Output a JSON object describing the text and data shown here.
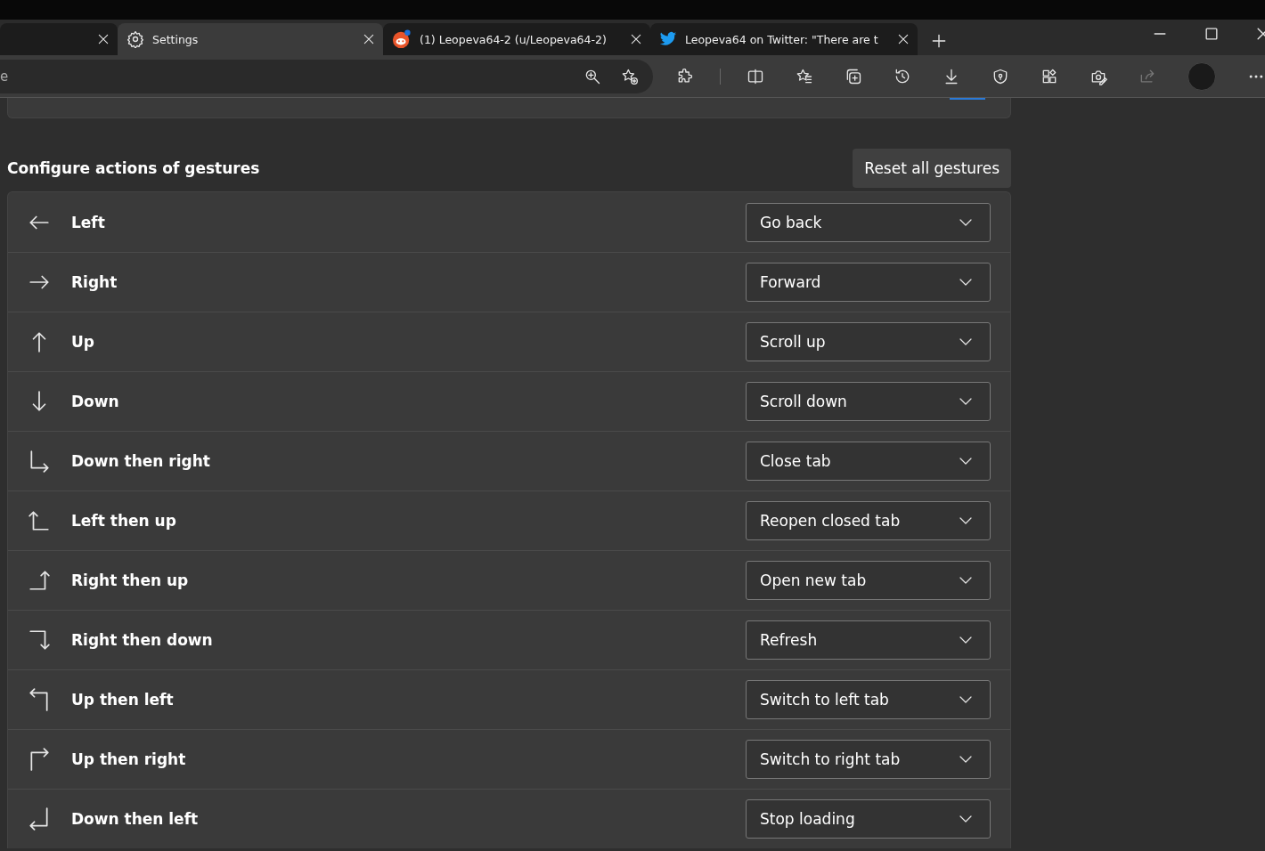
{
  "tabs": [
    {
      "kind": "none",
      "selected": false
    },
    {
      "kind": "gear",
      "label": "Settings",
      "selected": true
    },
    {
      "kind": "alien",
      "label": "(1) Leopeva64-2 (u/Leopeva64-2)",
      "selected": false
    },
    {
      "kind": "bird",
      "label": "Leopeva64 on Twitter: \"There are t",
      "selected": false
    }
  ],
  "address_bar": {
    "value": "e"
  },
  "section": {
    "title": "Configure actions of gestures",
    "reset_button": "Reset all gestures"
  },
  "gestures": [
    {
      "kind": "left",
      "label": "Left",
      "action": "Go back"
    },
    {
      "kind": "right",
      "label": "Right",
      "action": "Forward"
    },
    {
      "kind": "up",
      "label": "Up",
      "action": "Scroll up"
    },
    {
      "kind": "down",
      "label": "Down",
      "action": "Scroll down"
    },
    {
      "kind": "down-right",
      "label": "Down then right",
      "action": "Close tab"
    },
    {
      "kind": "left-up",
      "label": "Left then up",
      "action": "Reopen closed tab"
    },
    {
      "kind": "right-up",
      "label": "Right then up",
      "action": "Open new tab"
    },
    {
      "kind": "right-down",
      "label": "Right then down",
      "action": "Refresh"
    },
    {
      "kind": "up-left",
      "label": "Up then left",
      "action": "Switch to left tab"
    },
    {
      "kind": "up-right",
      "label": "Up then right",
      "action": "Switch to right tab"
    },
    {
      "kind": "down-left",
      "label": "Down then left",
      "action": "Stop loading"
    }
  ]
}
